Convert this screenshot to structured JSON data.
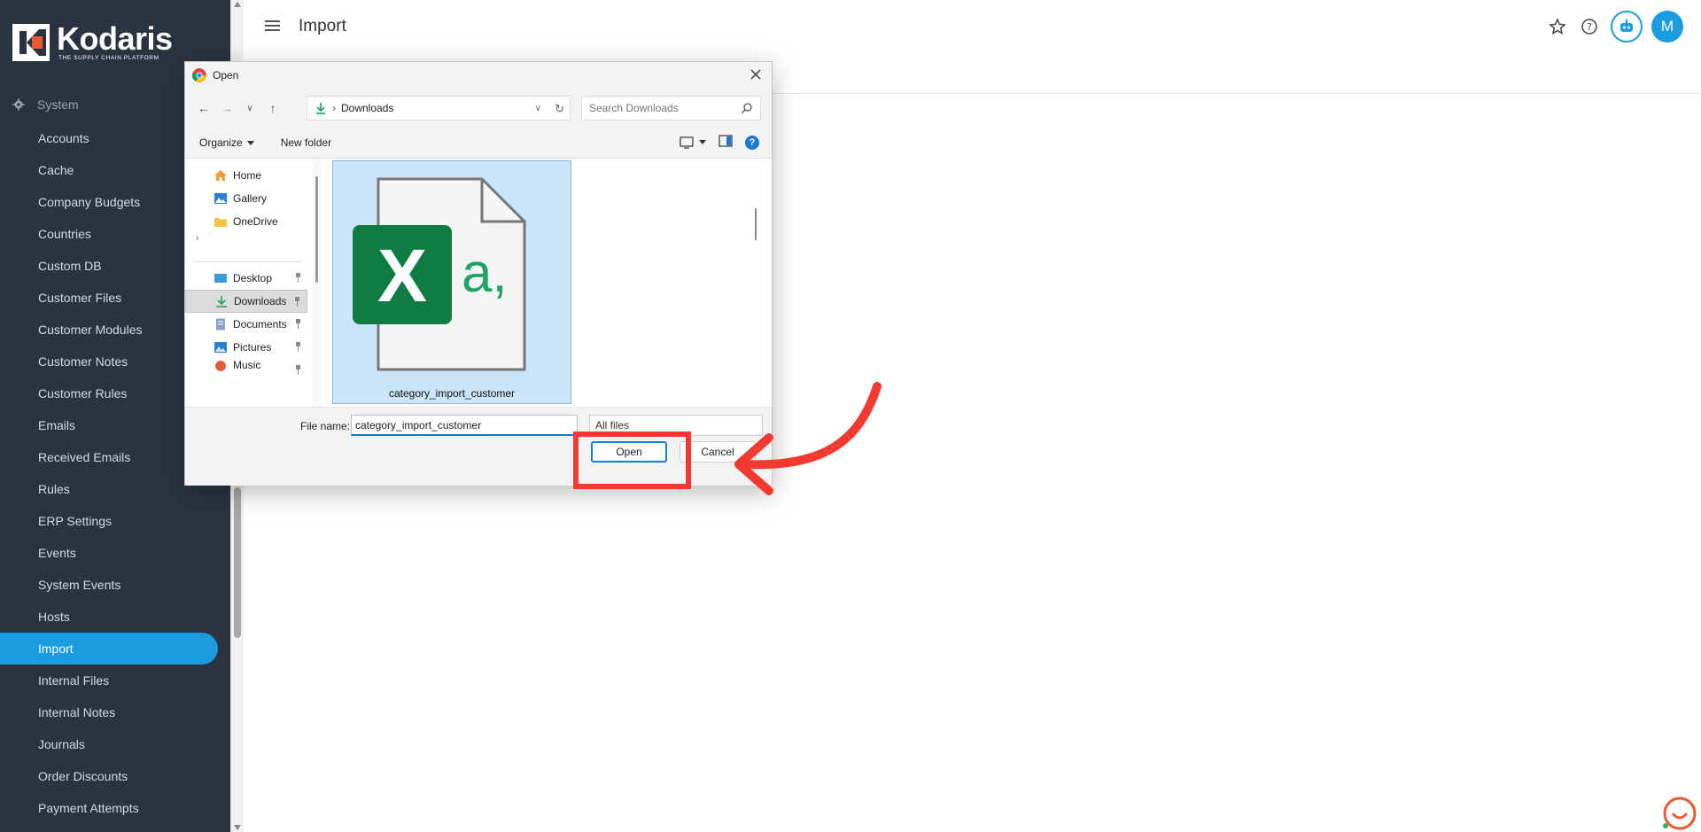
{
  "brand": {
    "name": "Kodaris",
    "tagline": "THE SUPPLY CHAIN PLATFORM"
  },
  "sidebar": {
    "section": "System",
    "items": [
      {
        "label": "Accounts"
      },
      {
        "label": "Cache"
      },
      {
        "label": "Company Budgets"
      },
      {
        "label": "Countries"
      },
      {
        "label": "Custom DB"
      },
      {
        "label": "Customer Files"
      },
      {
        "label": "Customer Modules"
      },
      {
        "label": "Customer Notes"
      },
      {
        "label": "Customer Rules"
      },
      {
        "label": "Emails"
      },
      {
        "label": "Received Emails"
      },
      {
        "label": "Rules"
      },
      {
        "label": "ERP Settings"
      },
      {
        "label": "Events"
      },
      {
        "label": "System Events"
      },
      {
        "label": "Hosts"
      },
      {
        "label": "Import"
      },
      {
        "label": "Internal Files"
      },
      {
        "label": "Internal Notes"
      },
      {
        "label": "Journals"
      },
      {
        "label": "Order Discounts"
      },
      {
        "label": "Payment Attempts"
      }
    ],
    "active_index": 16
  },
  "header": {
    "title": "Import",
    "avatar_initial": "M"
  },
  "dialog": {
    "title": "Open",
    "breadcrumb": "Downloads",
    "search_placeholder": "Search Downloads",
    "organize_label": "Organize",
    "new_folder_label": "New folder",
    "nav": {
      "home": "Home",
      "gallery": "Gallery",
      "onedrive": "OneDrive",
      "desktop": "Desktop",
      "downloads": "Downloads",
      "documents": "Documents",
      "pictures": "Pictures",
      "music": "Music"
    },
    "file": {
      "name": "category_import_customer",
      "icon_letters": "X",
      "icon_suffix": "a,"
    },
    "file_name_label": "File name:",
    "file_name_value": "category_import_customer",
    "file_type_value": "All files",
    "open_label": "Open",
    "cancel_label": "Cancel"
  },
  "colors": {
    "sidebar_bg": "#2c3340",
    "accent": "#1b9be0",
    "annotation": "#f23a30",
    "excel_green": "#107c41"
  }
}
